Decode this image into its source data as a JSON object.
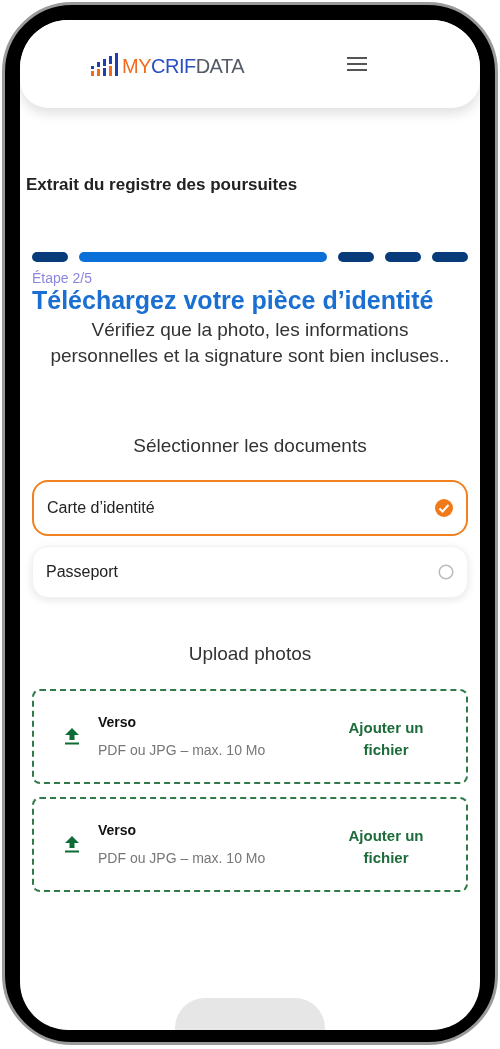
{
  "header": {
    "logo_parts": [
      "MY",
      "CRIF",
      "DATA"
    ]
  },
  "page_title": "Extrait du registre des poursuites",
  "steps": [
    {
      "selected": false
    },
    {
      "selected": true
    },
    {
      "selected": false
    },
    {
      "selected": false
    },
    {
      "selected": false
    }
  ],
  "step_label": "Étape 2/5",
  "heading": "Téléchargez votre pièce d’identité",
  "description": "Vérifiez que la photo, les informations personnelles et la signature sont bien incluses..",
  "documents": {
    "title": "Sélectionner les documents",
    "options": [
      {
        "label": "Carte d’identité",
        "selected": true
      },
      {
        "label": "Passeport",
        "selected": false
      }
    ]
  },
  "upload": {
    "title": "Upload photos",
    "slots": [
      {
        "name": "Verso",
        "hint": "PDF ou JPG – max. 10 Mo",
        "action": "Ajouter un fichier"
      },
      {
        "name": "Verso",
        "hint": "PDF ou JPG – max. 10 Mo",
        "action": "Ajouter un fichier"
      }
    ]
  }
}
